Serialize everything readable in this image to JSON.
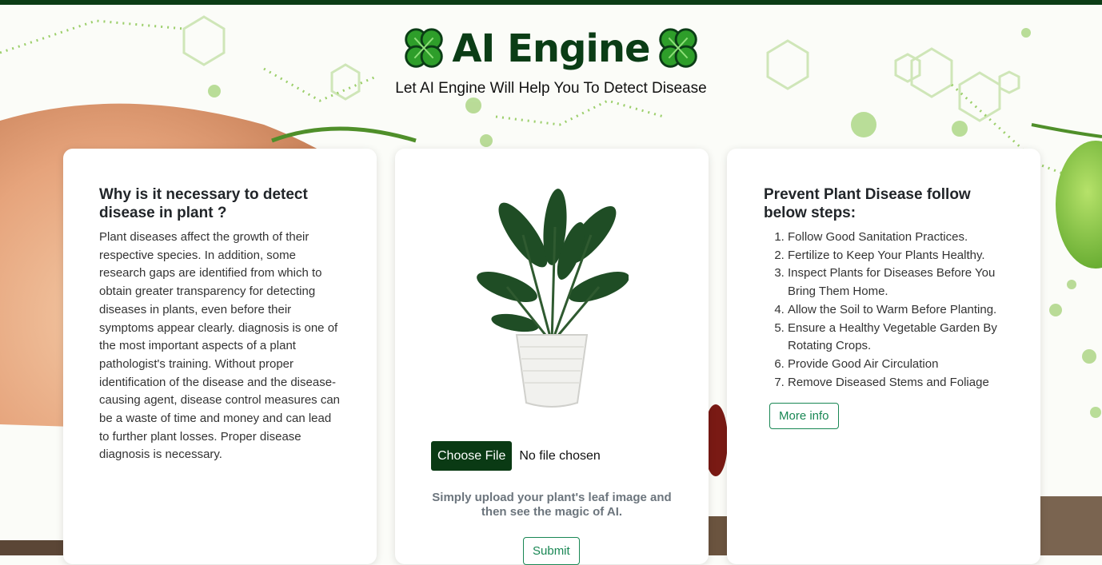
{
  "header": {
    "title": "AI Engine",
    "subtitle": "Let AI Engine Will Help You To Detect Disease"
  },
  "left_card": {
    "heading": "Why is it necessary to detect disease in plant ?",
    "body": "Plant diseases affect the growth of their respective species. In addition, some research gaps are identified from which to obtain greater transparency for detecting diseases in plants, even before their symptoms appear clearly. diagnosis is one of the most important aspects of a plant pathologist's training. Without proper identification of the disease and the disease-causing agent, disease control measures can be a waste of time and money and can lead to further plant losses. Proper disease diagnosis is necessary."
  },
  "upload_card": {
    "choose_file_label": "Choose File",
    "file_status": "No file chosen",
    "hint": "Simply upload your plant's leaf image and then see the magic of AI.",
    "submit_label": "Submit"
  },
  "right_card": {
    "heading": "Prevent Plant Disease follow below steps:",
    "steps": [
      "Follow Good Sanitation Practices.",
      "Fertilize to Keep Your Plants Healthy.",
      "Inspect Plants for Diseases Before You Bring Them Home.",
      "Allow the Soil to Warm Before Planting.",
      "Ensure a Healthy Vegetable Garden By Rotating Crops.",
      "Provide Good Air Circulation",
      "Remove Diseased Stems and Foliage"
    ],
    "more_info_label": "More info"
  },
  "colors": {
    "brand_dark_green": "#0b3d16",
    "accent_green": "#198754",
    "clover_green": "#2e9e2a"
  },
  "icons": [
    "four-leaf-clover-icon",
    "plant-image"
  ]
}
